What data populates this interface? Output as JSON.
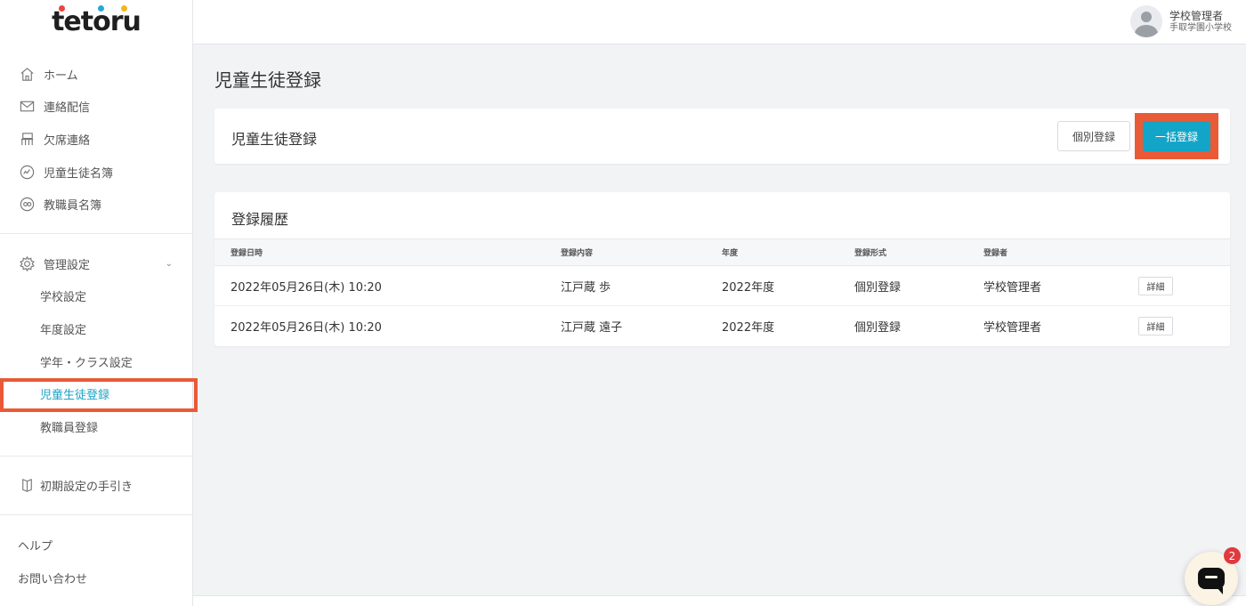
{
  "brand": {
    "logo_text": "tetoru",
    "dot_colors": [
      "#e8453c",
      "#2aa6d8",
      "#f2b61b"
    ]
  },
  "user": {
    "name": "学校管理者",
    "school": "手取学園小学校"
  },
  "sidebar": {
    "main_items": [
      {
        "label": "ホーム",
        "icon": "home-icon"
      },
      {
        "label": "連絡配信",
        "icon": "mail-icon"
      },
      {
        "label": "欠席連絡",
        "icon": "desk-icon"
      },
      {
        "label": "児童生徒名簿",
        "icon": "student-list-icon"
      },
      {
        "label": "教職員名簿",
        "icon": "staff-list-icon"
      }
    ],
    "settings": {
      "label": "管理設定",
      "sub_items": [
        {
          "label": "学校設定"
        },
        {
          "label": "年度設定"
        },
        {
          "label": "学年・クラス設定"
        },
        {
          "label": "児童生徒登録"
        },
        {
          "label": "教職員登録"
        }
      ]
    },
    "guide": {
      "label": "初期設定の手引き"
    },
    "footer": [
      {
        "label": "ヘルプ"
      },
      {
        "label": "お問い合わせ"
      }
    ]
  },
  "page": {
    "title": "児童生徒登録",
    "registration_card": {
      "title": "児童生徒登録",
      "individual_button": "個別登録",
      "bulk_button": "一括登録"
    },
    "history": {
      "title": "登録履歴",
      "columns": [
        "登録日時",
        "登録内容",
        "年度",
        "登録形式",
        "登録者"
      ],
      "rows": [
        {
          "datetime": "2022年05月26日(木) 10:20",
          "content": "江戸蔵 歩",
          "year": "2022年度",
          "format": "個別登録",
          "registrar": "学校管理者",
          "detail": "詳細"
        },
        {
          "datetime": "2022年05月26日(木) 10:20",
          "content": "江戸蔵 遠子",
          "year": "2022年度",
          "format": "個別登録",
          "registrar": "学校管理者",
          "detail": "詳細"
        }
      ]
    }
  },
  "chat": {
    "badge_count": "2"
  },
  "colors": {
    "accent": "#12a5c7",
    "highlight": "#e95a36",
    "active_text": "#1aa3c4"
  }
}
